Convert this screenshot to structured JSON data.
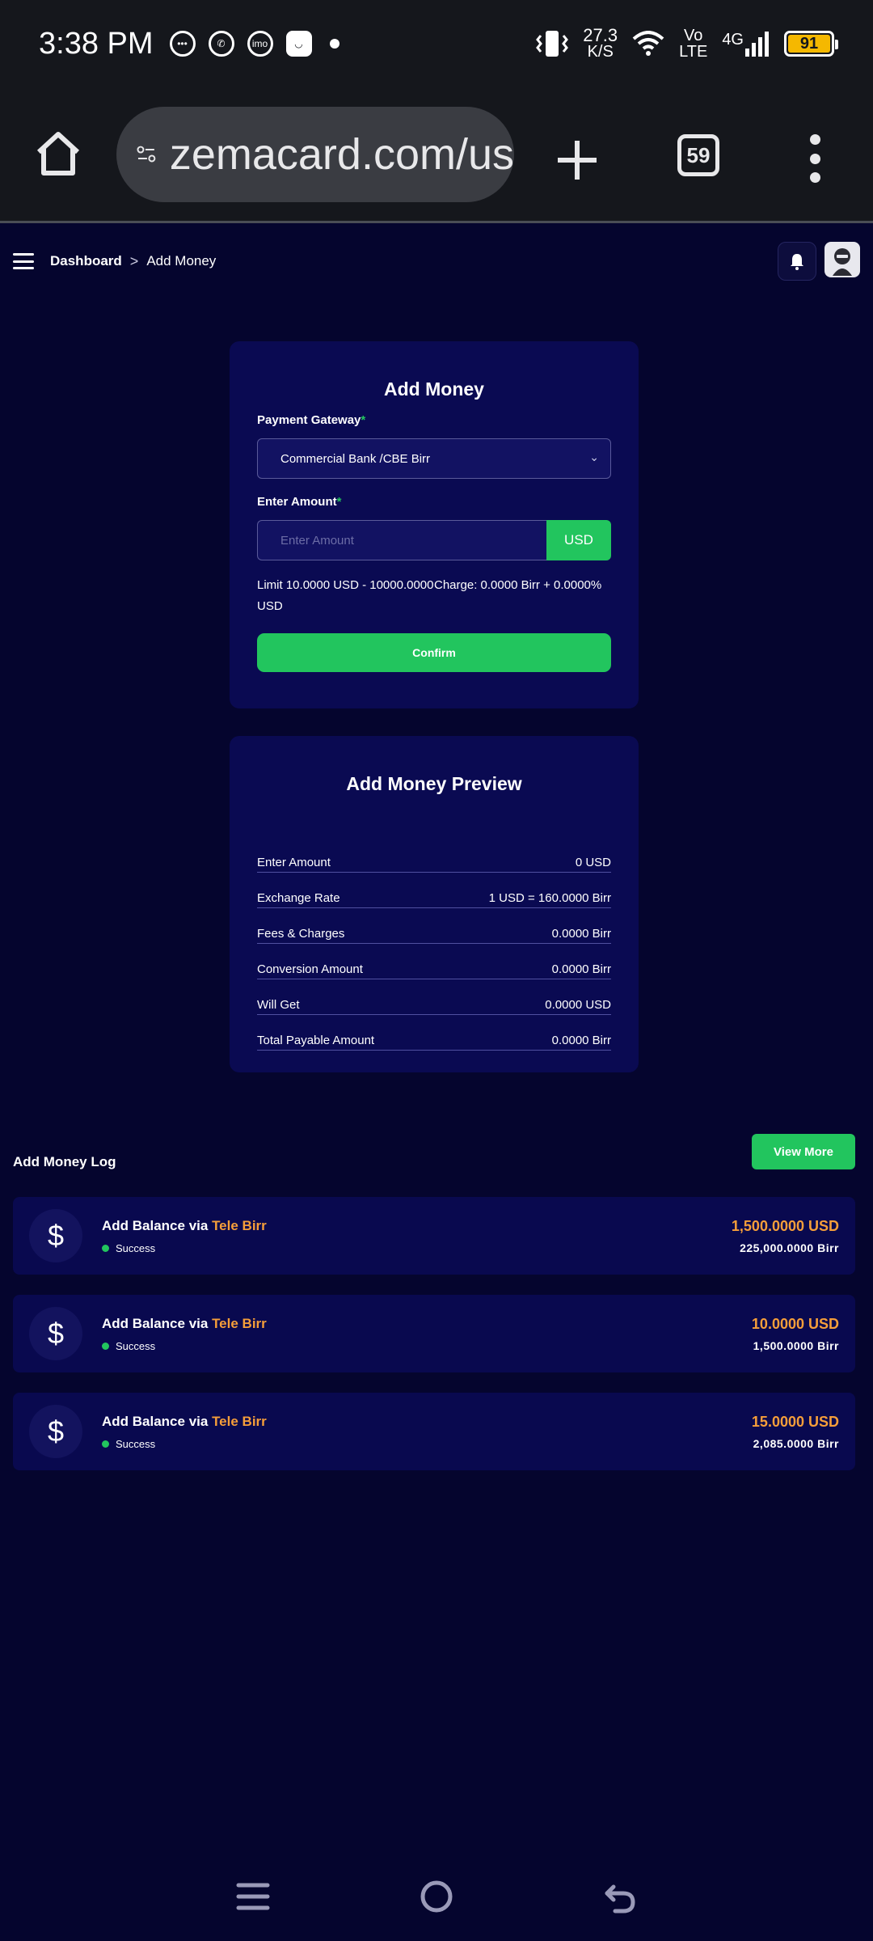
{
  "status_bar": {
    "time": "3:38 PM",
    "net_speed_value": "27.3",
    "net_speed_unit": "K/S",
    "volte_top": "Vo",
    "volte_bottom": "LTE",
    "network": "4G",
    "battery": "91"
  },
  "browser": {
    "url": "zemacard.com/us",
    "tab_count": "59"
  },
  "header": {
    "breadcrumb_root": "Dashboard",
    "breadcrumb_sep": ">",
    "breadcrumb_current": "Add Money"
  },
  "add_money": {
    "title": "Add Money",
    "gateway_label": "Payment Gateway",
    "required_mark": "*",
    "gateway_value": "Commercial Bank /CBE Birr",
    "amount_label": "Enter Amount",
    "amount_placeholder": "Enter Amount",
    "amount_unit": "USD",
    "limit_text": "Limit 10.0000 USD - 10000.0000 USD",
    "charge_text": "Charge: 0.0000 Birr + 0.0000%",
    "confirm_label": "Confirm"
  },
  "preview": {
    "title": "Add Money Preview",
    "rows": [
      {
        "label": "Enter Amount",
        "value": "0 USD"
      },
      {
        "label": "Exchange Rate",
        "value": "1 USD = 160.0000 Birr"
      },
      {
        "label": "Fees & Charges",
        "value": "0.0000 Birr"
      },
      {
        "label": "Conversion Amount",
        "value": "0.0000 Birr"
      },
      {
        "label": "Will Get",
        "value": "0.0000 USD"
      },
      {
        "label": "Total Payable Amount",
        "value": "0.0000 Birr"
      }
    ]
  },
  "log": {
    "title": "Add Money Log",
    "view_more_label": "View More",
    "items": [
      {
        "prefix": "Add Balance via",
        "method": "Tele Birr",
        "status": "Success",
        "usd": "1,500.0000 USD",
        "birr": "225,000.0000 Birr"
      },
      {
        "prefix": "Add Balance via",
        "method": "Tele Birr",
        "status": "Success",
        "usd": "10.0000 USD",
        "birr": "1,500.0000 Birr"
      },
      {
        "prefix": "Add Balance via",
        "method": "Tele Birr",
        "status": "Success",
        "usd": "15.0000 USD",
        "birr": "2,085.0000 Birr"
      }
    ]
  },
  "colors": {
    "background": "#05052e",
    "card": "#0a0a52",
    "accent_green": "#22c55e",
    "accent_orange": "#f59e3a"
  }
}
